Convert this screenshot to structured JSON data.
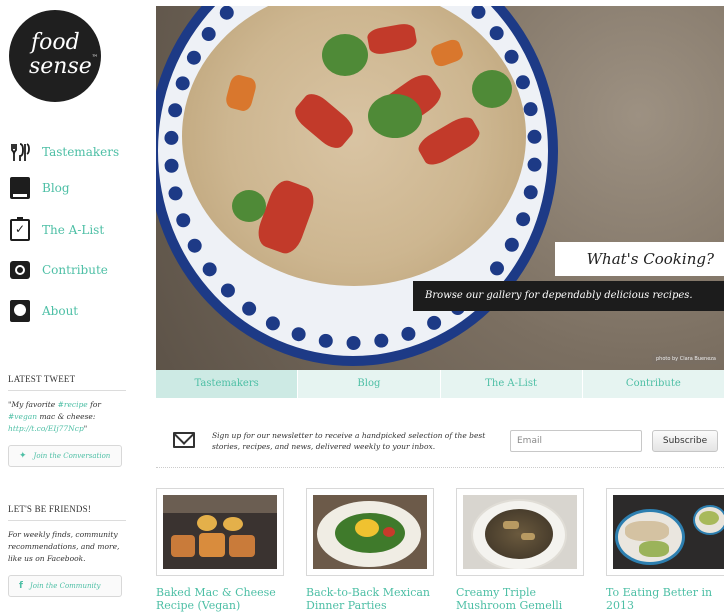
{
  "logo": {
    "line1": "food",
    "line2": "sense",
    "tm": "™"
  },
  "nav": {
    "items": [
      {
        "label": "Tastemakers",
        "icon": "tastemakers-icon"
      },
      {
        "label": "Blog",
        "icon": "book-icon"
      },
      {
        "label": "The A-List",
        "icon": "clipboard-check-icon"
      },
      {
        "label": "Contribute",
        "icon": "camera-icon"
      },
      {
        "label": "About",
        "icon": "about-icon"
      }
    ]
  },
  "latest_tweet": {
    "heading": "LATEST TWEET",
    "text_before": "\"My favorite ",
    "link1": "#recipe",
    "text_mid": " for ",
    "link2": "#vegan",
    "text_after": " mac & cheese: ",
    "url": "http://t.co/EIj77Ncp",
    "text_end": "\"",
    "button_label": "Join the Conversation",
    "button_icon": "twitter-bird-icon"
  },
  "friends": {
    "heading": "LET'S BE FRIENDS!",
    "text": "For weekly finds, community recommendations, and more, like us on Facebook.",
    "button_label": "Join the Community",
    "button_icon": "facebook-icon"
  },
  "hero": {
    "title": "What's Cooking?",
    "subtitle": "Browse our gallery for dependably delicious recipes.",
    "credit": "photo by Clara Bueneza"
  },
  "tabs": [
    {
      "label": "Tastemakers",
      "active": true
    },
    {
      "label": "Blog",
      "active": false
    },
    {
      "label": "The A-List",
      "active": false
    },
    {
      "label": "Contribute",
      "active": false
    }
  ],
  "newsletter": {
    "text": "Sign up for our newsletter to receive a handpicked selection of the best stories, recipes, and news, delivered weekly to your inbox.",
    "email_placeholder": "Email",
    "subscribe_label": "Subscribe"
  },
  "cards": [
    {
      "title": "Baked Mac & Cheese\nRecipe (Vegan)"
    },
    {
      "title": "Back-to-Back Mexican\nDinner Parties"
    },
    {
      "title": "Creamy Triple\nMushroom Gemelli"
    },
    {
      "title": "To Eating Better in\n2013"
    }
  ],
  "colors": {
    "accent": "#4dbfa5",
    "tab_bg": "#e6f4f1",
    "tab_active": "#cdeae4",
    "dark": "#1c1c1c"
  }
}
